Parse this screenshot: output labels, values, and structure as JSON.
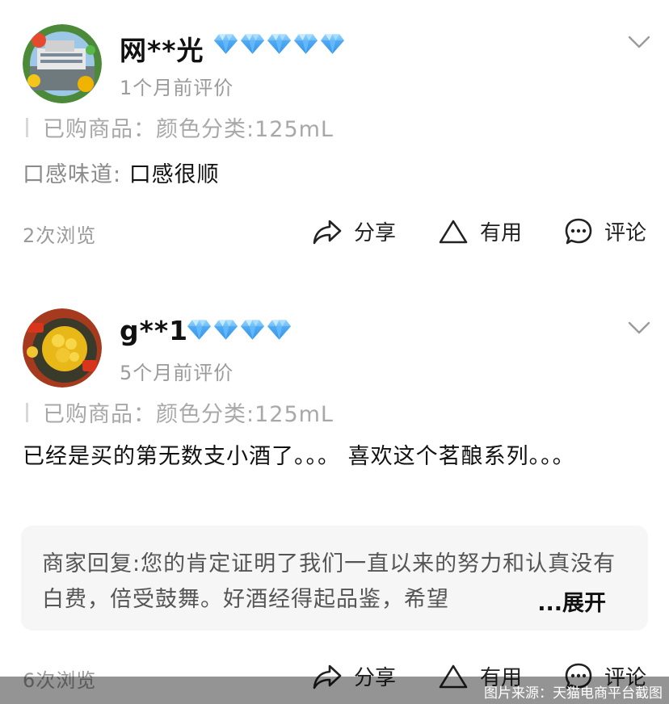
{
  "reviews": [
    {
      "username": "网**光",
      "diamond_count": 5,
      "time": "1个月前评价",
      "spec": "已购商品：颜色分类:125mL",
      "taste_label": "口感味道: ",
      "taste_value": "口感很顺",
      "views": "2次浏览",
      "actions": {
        "share": "分享",
        "useful": "有用",
        "comment": "评论"
      }
    },
    {
      "username": "g**1",
      "diamond_count": 4,
      "time": "5个月前评价",
      "spec": "已购商品：颜色分类:125mL",
      "content": "已经是买的第无数支小酒了。。。 喜欢这个茗酿系列。。。",
      "reply": "商家回复:您的肯定证明了我们一直以来的努力和认真没有白费，倍受鼓舞。好酒经得起品鉴，希望",
      "reply_expand": "...展开",
      "views": "6次浏览",
      "actions": {
        "share": "分享",
        "useful": "有用",
        "comment": "评论"
      }
    }
  ],
  "watermark": "图片来源：天猫电商平台截图",
  "colors": {
    "diamond": "#4aa8f0",
    "muted": "#9b9b9b",
    "reply_bg": "#f6f6f6"
  },
  "icons": [
    "share-icon",
    "triangle-useful-icon",
    "comment-bubble-icon",
    "chevron-down-icon",
    "diamond-icon"
  ]
}
